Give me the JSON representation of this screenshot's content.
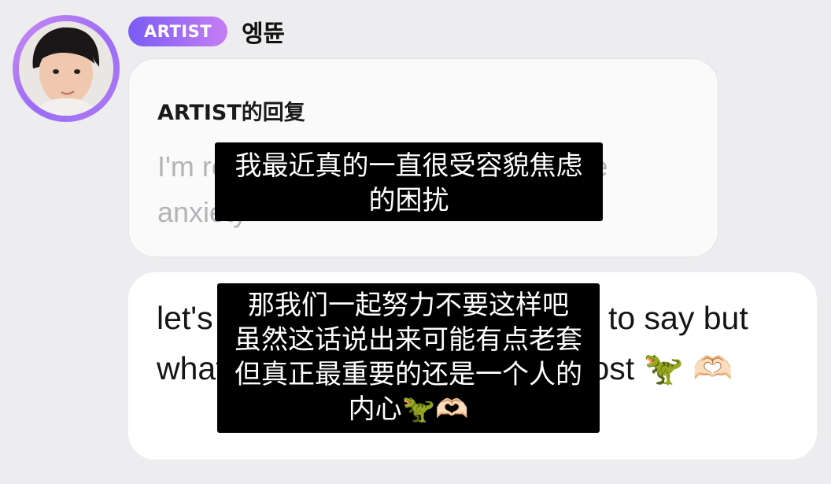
{
  "header": {
    "badge": "ARTIST",
    "username": "엥뜐"
  },
  "reply": {
    "title": "ARTIST的回复",
    "text": "I'm really suffering from appearance anxiety"
  },
  "message": {
    "text": "let's try not to do that. it's corny to say but what's on the inside matters most",
    "emoji_dino": "🦖",
    "emoji_heart_hands": "🫶🏻"
  },
  "subtitles": {
    "top": [
      "我最近真的一直很受容貌焦虑",
      "的困扰"
    ],
    "bottom": [
      "那我们一起努力不要这样吧",
      "虽然这话说出来可能有点老套",
      "但真正最重要的还是一个人的",
      "内心🦖🫶🏻"
    ]
  },
  "colors": {
    "background": "#ededef",
    "badge_gradient_start": "#7a5cf4",
    "badge_gradient_end": "#c57ef3",
    "avatar_ring": "#b07cf4"
  }
}
